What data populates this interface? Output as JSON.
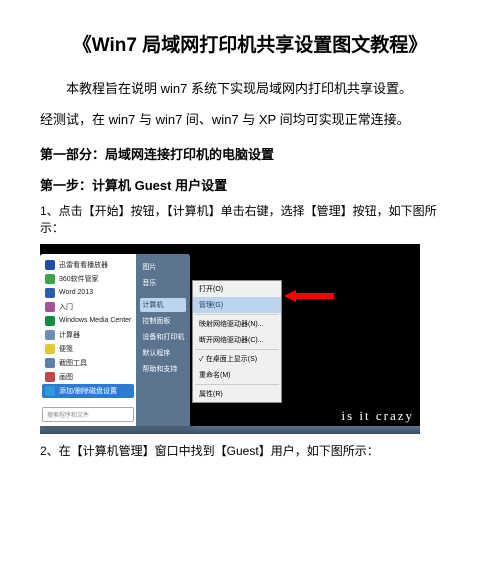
{
  "title": "《Win7 局域网打印机共享设置图文教程》",
  "intro1": "本教程旨在说明 win7 系统下实现局域网内打印机共享设置。",
  "intro2": "经测试，在 win7 与 win7 间、win7 与 XP 间均可实现正常连接。",
  "section1": "第一部分：局域网连接打印机的电脑设置",
  "step1_head": "第一步：计算机 Guest 用户设置",
  "step1_1": "1、点击【开始】按钮，【计算机】单击右键，选择【管理】按钮，如下图所示：",
  "step1_2": "2、在【计算机管理】窗口中找到【Guest】用户，如下图所示：",
  "start_left": [
    {
      "label": "迅雷看看播放器",
      "c": "#1e4ea8"
    },
    {
      "label": "360软件管家",
      "c": "#3fa544"
    },
    {
      "label": "Word 2013",
      "c": "#2a5db0"
    },
    {
      "label": "入门",
      "c": "#a64f9a"
    },
    {
      "label": "Windows Media Center",
      "c": "#0d8f3f"
    },
    {
      "label": "计算器",
      "c": "#6b8fb5"
    },
    {
      "label": "便笺",
      "c": "#e6c63a"
    },
    {
      "label": "截图工具",
      "c": "#5b7fae"
    },
    {
      "label": "画图",
      "c": "#c14848"
    },
    {
      "label": "添加/删除磁盘设置",
      "c": "#2a9bd6",
      "hl": true
    }
  ],
  "search_placeholder": "搜索程序和文件",
  "start_right": [
    "图片",
    "音乐",
    "",
    "计算机",
    "控制面板",
    "设备和打印机",
    "默认程序",
    "帮助和支持"
  ],
  "right_hl_index": 3,
  "ctx": [
    {
      "label": "打开(O)"
    },
    {
      "label": "管理(G)",
      "hl": true
    },
    {
      "sep": true
    },
    {
      "label": "映射网络驱动器(N)..."
    },
    {
      "label": "断开网络驱动器(C)..."
    },
    {
      "sep": true
    },
    {
      "label": "在桌面上显示(S)",
      "check": true
    },
    {
      "label": "重命名(M)"
    },
    {
      "sep": true
    },
    {
      "label": "属性(R)"
    }
  ],
  "watermark": "is it crazy"
}
